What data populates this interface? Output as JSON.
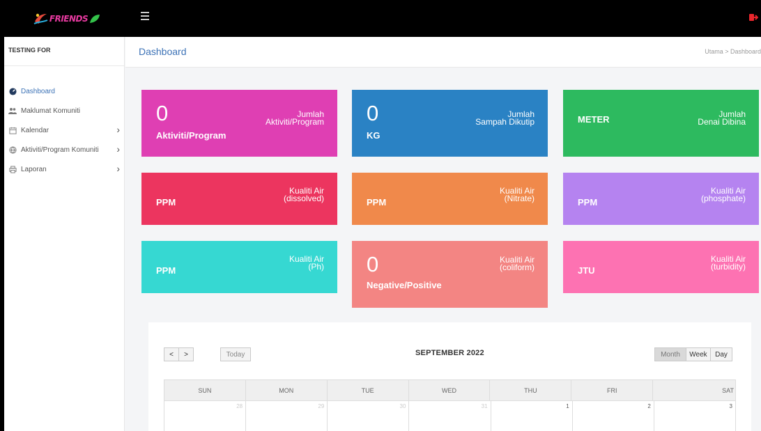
{
  "app": {
    "logo_text": "FRIENDS",
    "logout_icon": "logout-icon"
  },
  "sidebar": {
    "heading": "TESTING FOR",
    "items": [
      {
        "label": "Dashboard",
        "icon": "dashboard-icon",
        "active": true,
        "has_arrow": false
      },
      {
        "label": "Maklumat Komuniti",
        "icon": "users-icon",
        "active": false,
        "has_arrow": false
      },
      {
        "label": "Kalendar",
        "icon": "calendar-icon",
        "active": false,
        "has_arrow": true
      },
      {
        "label": "Aktiviti/Program Komuniti",
        "icon": "globe-icon",
        "active": false,
        "has_arrow": true
      },
      {
        "label": "Laporan",
        "icon": "print-icon",
        "active": false,
        "has_arrow": true
      }
    ]
  },
  "header": {
    "title": "Dashboard",
    "breadcrumb": "Utama  >  Dashboard"
  },
  "tiles": [
    {
      "value": "0",
      "unit": "Aktiviti/Program",
      "label": "Jumlah\nAktiviti/Program",
      "color": "#df3fb3"
    },
    {
      "value": "0",
      "unit": "KG",
      "label": "Jumlah\nSampah Dikutip",
      "color": "#2a82c4"
    },
    {
      "value": "",
      "unit": "METER",
      "label": "Jumlah\nDenai Dibina",
      "color": "#2dba5f"
    },
    {
      "value": "",
      "unit": "PPM",
      "label": "Kualiti Air\n(dissolved)",
      "color": "#ec355f"
    },
    {
      "value": "",
      "unit": "PPM",
      "label": "Kualiti Air\n(Nitrate)",
      "color": "#f0894b"
    },
    {
      "value": "",
      "unit": "PPM",
      "label": "Kualiti Air\n(phosphate)",
      "color": "#b583f0"
    },
    {
      "value": "",
      "unit": "PPM",
      "label": "Kualiti Air\n(Ph)",
      "color": "#36d8d2"
    },
    {
      "value": "0",
      "unit": "Negative/Positive",
      "label": "Kualiti Air\n(coliform)",
      "color": "#f38583"
    },
    {
      "value": "",
      "unit": "JTU",
      "label": "Kualiti Air\n(turbidity)",
      "color": "#fd72b2"
    }
  ],
  "calendar": {
    "prev": "<",
    "next": ">",
    "today": "Today",
    "title": "SEPTEMBER 2022",
    "views": [
      "Month",
      "Week",
      "Day"
    ],
    "active_view": "Month",
    "weekdays": [
      "SUN",
      "MON",
      "TUE",
      "WED",
      "THU",
      "FRI",
      "SAT"
    ],
    "first_week": [
      {
        "day": "28",
        "muted": true
      },
      {
        "day": "29",
        "muted": true
      },
      {
        "day": "30",
        "muted": true
      },
      {
        "day": "31",
        "muted": true
      },
      {
        "day": "1",
        "muted": false
      },
      {
        "day": "2",
        "muted": false
      },
      {
        "day": "3",
        "muted": false
      }
    ]
  }
}
